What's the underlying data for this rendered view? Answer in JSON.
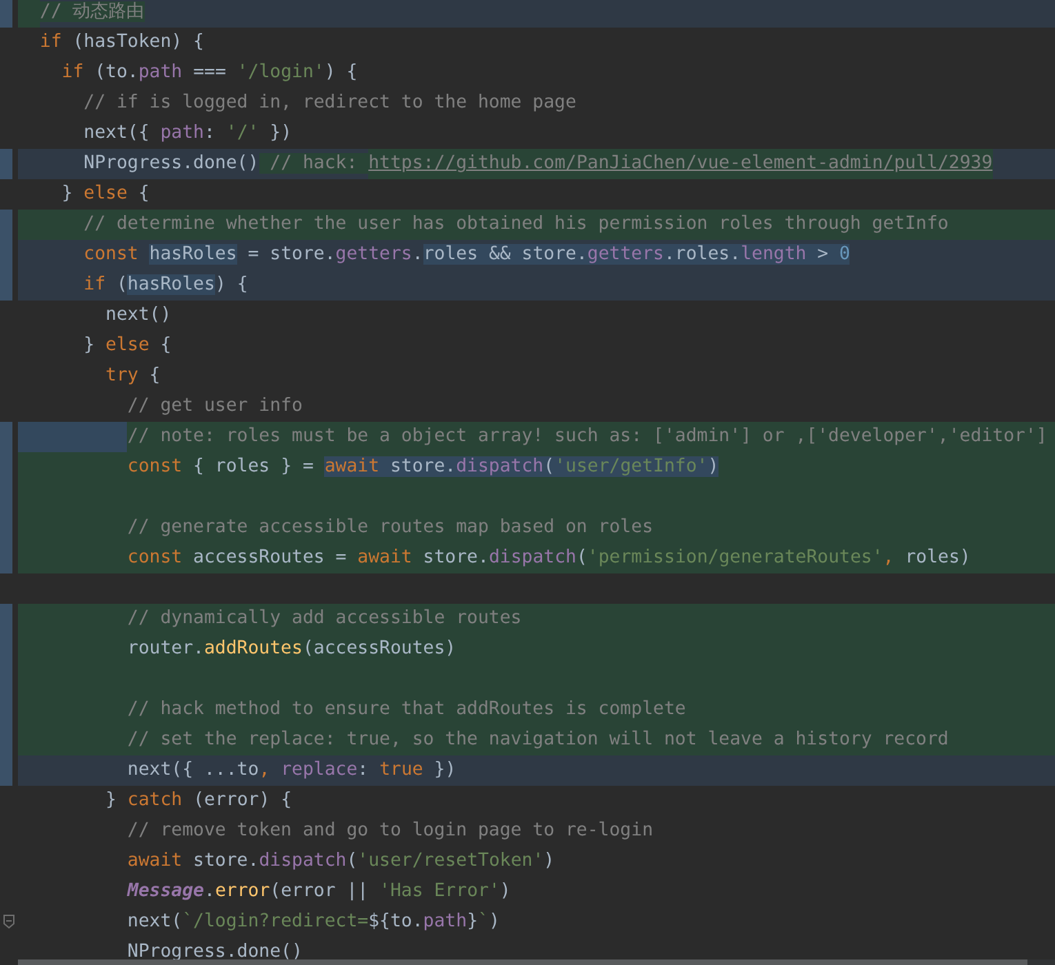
{
  "editor": {
    "lines": [
      {
        "kind": "current",
        "indent_selected": false,
        "tokens": [
          {
            "text": "  // 动态路由",
            "kind": "comment",
            "selected": false,
            "added": true
          }
        ]
      },
      {
        "kind": "plain",
        "indent_selected": false,
        "tokens": [
          {
            "text": "  if",
            "kind": "keyword",
            "selected": false,
            "added": false
          },
          {
            "text": " (hasToken) {",
            "kind": "plain",
            "selected": false,
            "added": false
          }
        ]
      },
      {
        "kind": "plain",
        "indent_selected": false,
        "tokens": [
          {
            "text": "    if",
            "kind": "keyword",
            "selected": false,
            "added": false
          },
          {
            "text": " (to.",
            "kind": "plain",
            "selected": false,
            "added": false
          },
          {
            "text": "path",
            "kind": "property",
            "selected": false,
            "added": false
          },
          {
            "text": " === ",
            "kind": "plain",
            "selected": false,
            "added": false
          },
          {
            "text": "'/login'",
            "kind": "string",
            "selected": false,
            "added": false
          },
          {
            "text": ") {",
            "kind": "plain",
            "selected": false,
            "added": false
          }
        ]
      },
      {
        "kind": "plain",
        "indent_selected": false,
        "tokens": [
          {
            "text": "      // if is logged in, redirect to the home page",
            "kind": "comment",
            "selected": false,
            "added": false
          }
        ]
      },
      {
        "kind": "plain",
        "indent_selected": false,
        "tokens": [
          {
            "text": "      next({ ",
            "kind": "plain",
            "selected": false,
            "added": false
          },
          {
            "text": "path",
            "kind": "property",
            "selected": false,
            "added": false
          },
          {
            "text": ": ",
            "kind": "plain",
            "selected": false,
            "added": false
          },
          {
            "text": "'/'",
            "kind": "string",
            "selected": false,
            "added": false
          },
          {
            "text": " })",
            "kind": "plain",
            "selected": false,
            "added": false
          }
        ]
      },
      {
        "kind": "current",
        "indent_selected": false,
        "tokens": [
          {
            "text": "      NProgress.done()",
            "kind": "plain",
            "selected": false,
            "added": false
          },
          {
            "text": " // hack: ",
            "kind": "comment",
            "selected": false,
            "added": true
          },
          {
            "text": "https://github.com/PanJiaChen/vue-element-admin/pull/2939",
            "kind": "link",
            "selected": false,
            "added": true
          }
        ]
      },
      {
        "kind": "plain",
        "indent_selected": false,
        "tokens": [
          {
            "text": "    }",
            "kind": "plain",
            "selected": false,
            "added": false
          },
          {
            "text": " else",
            "kind": "keyword",
            "selected": false,
            "added": false
          },
          {
            "text": " {",
            "kind": "plain",
            "selected": false,
            "added": false
          }
        ]
      },
      {
        "kind": "added",
        "indent_selected": false,
        "tokens": [
          {
            "text": "      // determine whether the user has obtained his permission roles through getInfo",
            "kind": "comment",
            "selected": false
          }
        ]
      },
      {
        "kind": "current",
        "indent_selected": false,
        "tokens": [
          {
            "text": "      const ",
            "kind": "keyword",
            "selected": false,
            "added": false
          },
          {
            "text": "hasRoles",
            "kind": "plain",
            "selected": true,
            "added": false
          },
          {
            "text": " = store.",
            "kind": "plain",
            "selected": false,
            "added": false
          },
          {
            "text": "getters",
            "kind": "property",
            "selected": false,
            "added": false
          },
          {
            "text": ".",
            "kind": "plain",
            "selected": false,
            "added": false
          },
          {
            "text": "roles && store.",
            "kind": "plain",
            "selected": true,
            "added": false
          },
          {
            "text": "getters",
            "kind": "property",
            "selected": true,
            "added": false
          },
          {
            "text": ".roles.",
            "kind": "plain",
            "selected": true,
            "added": false
          },
          {
            "text": "length",
            "kind": "property",
            "selected": true,
            "added": false
          },
          {
            "text": " > ",
            "kind": "plain",
            "selected": true,
            "added": false
          },
          {
            "text": "0",
            "kind": "number",
            "selected": true,
            "added": false
          }
        ]
      },
      {
        "kind": "current",
        "indent_selected": false,
        "tokens": [
          {
            "text": "      if",
            "kind": "keyword",
            "selected": false,
            "added": false
          },
          {
            "text": " (",
            "kind": "plain",
            "selected": false,
            "added": false
          },
          {
            "text": "hasRoles",
            "kind": "plain",
            "selected": true,
            "added": false
          },
          {
            "text": ") {",
            "kind": "plain",
            "selected": false,
            "added": false
          }
        ]
      },
      {
        "kind": "plain",
        "indent_selected": false,
        "tokens": [
          {
            "text": "        next()",
            "kind": "plain",
            "selected": false,
            "added": false
          }
        ]
      },
      {
        "kind": "plain",
        "indent_selected": false,
        "tokens": [
          {
            "text": "      }",
            "kind": "plain",
            "selected": false,
            "added": false
          },
          {
            "text": " else",
            "kind": "keyword",
            "selected": false,
            "added": false
          },
          {
            "text": " {",
            "kind": "plain",
            "selected": false,
            "added": false
          }
        ]
      },
      {
        "kind": "plain",
        "indent_selected": false,
        "tokens": [
          {
            "text": "        try",
            "kind": "keyword",
            "selected": false,
            "added": false
          },
          {
            "text": " {",
            "kind": "plain",
            "selected": false,
            "added": false
          }
        ]
      },
      {
        "kind": "plain",
        "indent_selected": false,
        "tokens": [
          {
            "text": "          // get user info",
            "kind": "comment",
            "selected": false,
            "added": false
          }
        ]
      },
      {
        "kind": "added",
        "indent_selected": true,
        "tokens": [
          {
            "text": "          // note: roles must be a object array! such as: ['admin'] or ,['developer','editor']",
            "kind": "comment",
            "selected": false
          }
        ]
      },
      {
        "kind": "added",
        "indent_selected": false,
        "tokens": [
          {
            "text": "          const",
            "kind": "keyword",
            "selected": false
          },
          {
            "text": " { roles } = ",
            "kind": "plain",
            "selected": false
          },
          {
            "text": "await",
            "kind": "keyword",
            "selected": true
          },
          {
            "text": " store.",
            "kind": "plain",
            "selected": true
          },
          {
            "text": "dispatch",
            "kind": "property",
            "selected": true
          },
          {
            "text": "(",
            "kind": "plain",
            "selected": true
          },
          {
            "text": "'user/getInfo'",
            "kind": "string",
            "selected": true
          },
          {
            "text": ")",
            "kind": "plain",
            "selected": true
          }
        ]
      },
      {
        "kind": "added",
        "indent_selected": false
      },
      {
        "kind": "added",
        "indent_selected": false,
        "tokens": [
          {
            "text": "          // generate accessible routes map based on roles",
            "kind": "comment",
            "selected": false
          }
        ]
      },
      {
        "kind": "added",
        "indent_selected": false,
        "tokens": [
          {
            "text": "          const",
            "kind": "keyword",
            "selected": false
          },
          {
            "text": " accessRoutes = ",
            "kind": "plain",
            "selected": false
          },
          {
            "text": "await",
            "kind": "keyword",
            "selected": false
          },
          {
            "text": " store.",
            "kind": "plain",
            "selected": false
          },
          {
            "text": "dispatch",
            "kind": "property",
            "selected": false
          },
          {
            "text": "(",
            "kind": "plain",
            "selected": false
          },
          {
            "text": "'permission/generateRoutes'",
            "kind": "string",
            "selected": false
          },
          {
            "text": ",",
            "kind": "keyword",
            "selected": false
          },
          {
            "text": " roles)",
            "kind": "plain",
            "selected": false
          }
        ]
      },
      {
        "kind": "plain",
        "indent_selected": false
      },
      {
        "kind": "added",
        "indent_selected": false,
        "tokens": [
          {
            "text": "          // dynamically add accessible routes",
            "kind": "comment",
            "selected": false
          }
        ]
      },
      {
        "kind": "added",
        "indent_selected": false,
        "tokens": [
          {
            "text": "          router.",
            "kind": "plain",
            "selected": false
          },
          {
            "text": "addRoutes",
            "kind": "function",
            "selected": false
          },
          {
            "text": "(accessRoutes)",
            "kind": "plain",
            "selected": false
          }
        ]
      },
      {
        "kind": "added",
        "indent_selected": false
      },
      {
        "kind": "added",
        "indent_selected": false,
        "tokens": [
          {
            "text": "          // hack method to ensure that addRoutes is complete",
            "kind": "comment",
            "selected": false
          }
        ]
      },
      {
        "kind": "added",
        "indent_selected": false,
        "tokens": [
          {
            "text": "          // set the replace: true, so the navigation will not leave a history record",
            "kind": "comment",
            "selected": false
          }
        ]
      },
      {
        "kind": "current",
        "indent_selected": false,
        "tokens": [
          {
            "text": "          next({ ...to",
            "kind": "plain",
            "selected": false,
            "added": false
          },
          {
            "text": ",",
            "kind": "keyword",
            "selected": false,
            "added": false
          },
          {
            "text": " replace",
            "kind": "property",
            "selected": false,
            "added": false
          },
          {
            "text": ": ",
            "kind": "plain",
            "selected": false,
            "added": false
          },
          {
            "text": "true",
            "kind": "keyword",
            "selected": false,
            "added": false
          },
          {
            "text": " })",
            "kind": "plain",
            "selected": false,
            "added": false
          }
        ]
      },
      {
        "kind": "plain",
        "indent_selected": false,
        "tokens": [
          {
            "text": "        }",
            "kind": "plain",
            "selected": false,
            "added": false
          },
          {
            "text": " catch",
            "kind": "keyword",
            "selected": false,
            "added": false
          },
          {
            "text": " (error) {",
            "kind": "plain",
            "selected": false,
            "added": false
          }
        ]
      },
      {
        "kind": "plain",
        "indent_selected": false,
        "tokens": [
          {
            "text": "          // remove token and go to login page to re-login",
            "kind": "comment",
            "selected": false,
            "added": false
          }
        ]
      },
      {
        "kind": "plain",
        "indent_selected": false,
        "tokens": [
          {
            "text": "          await",
            "kind": "keyword",
            "selected": false,
            "added": false
          },
          {
            "text": " store.",
            "kind": "plain",
            "selected": false,
            "added": false
          },
          {
            "text": "dispatch",
            "kind": "property",
            "selected": false,
            "added": false
          },
          {
            "text": "(",
            "kind": "plain",
            "selected": false,
            "added": false
          },
          {
            "text": "'user/resetToken'",
            "kind": "string",
            "selected": false,
            "added": false
          },
          {
            "text": ")",
            "kind": "plain",
            "selected": false,
            "added": false
          }
        ]
      },
      {
        "kind": "plain",
        "indent_selected": false,
        "tokens": [
          {
            "text": "          Message",
            "kind": "class",
            "selected": false,
            "added": false
          },
          {
            "text": ".",
            "kind": "plain",
            "selected": false,
            "added": false
          },
          {
            "text": "error",
            "kind": "function",
            "selected": false,
            "added": false
          },
          {
            "text": "(error || ",
            "kind": "plain",
            "selected": false,
            "added": false
          },
          {
            "text": "'Has Error'",
            "kind": "string",
            "selected": false,
            "added": false
          },
          {
            "text": ")",
            "kind": "plain",
            "selected": false,
            "added": false
          }
        ]
      },
      {
        "kind": "plain",
        "indent_selected": false,
        "fold": true,
        "tokens": [
          {
            "text": "          next(",
            "kind": "plain",
            "selected": false,
            "added": false
          },
          {
            "text": "`/login?redirect=",
            "kind": "string",
            "selected": false,
            "added": false
          },
          {
            "text": "${to.",
            "kind": "plain",
            "selected": false,
            "added": false
          },
          {
            "text": "path",
            "kind": "property",
            "selected": false,
            "added": false
          },
          {
            "text": "}",
            "kind": "plain",
            "selected": false,
            "added": false
          },
          {
            "text": "`",
            "kind": "string",
            "selected": false,
            "added": false
          },
          {
            "text": ")",
            "kind": "plain",
            "selected": false,
            "added": false
          }
        ]
      },
      {
        "kind": "plain",
        "indent_selected": false,
        "tokens": [
          {
            "text": "          NProgress.done()",
            "kind": "plain",
            "selected": false,
            "added": false
          }
        ]
      }
    ]
  }
}
